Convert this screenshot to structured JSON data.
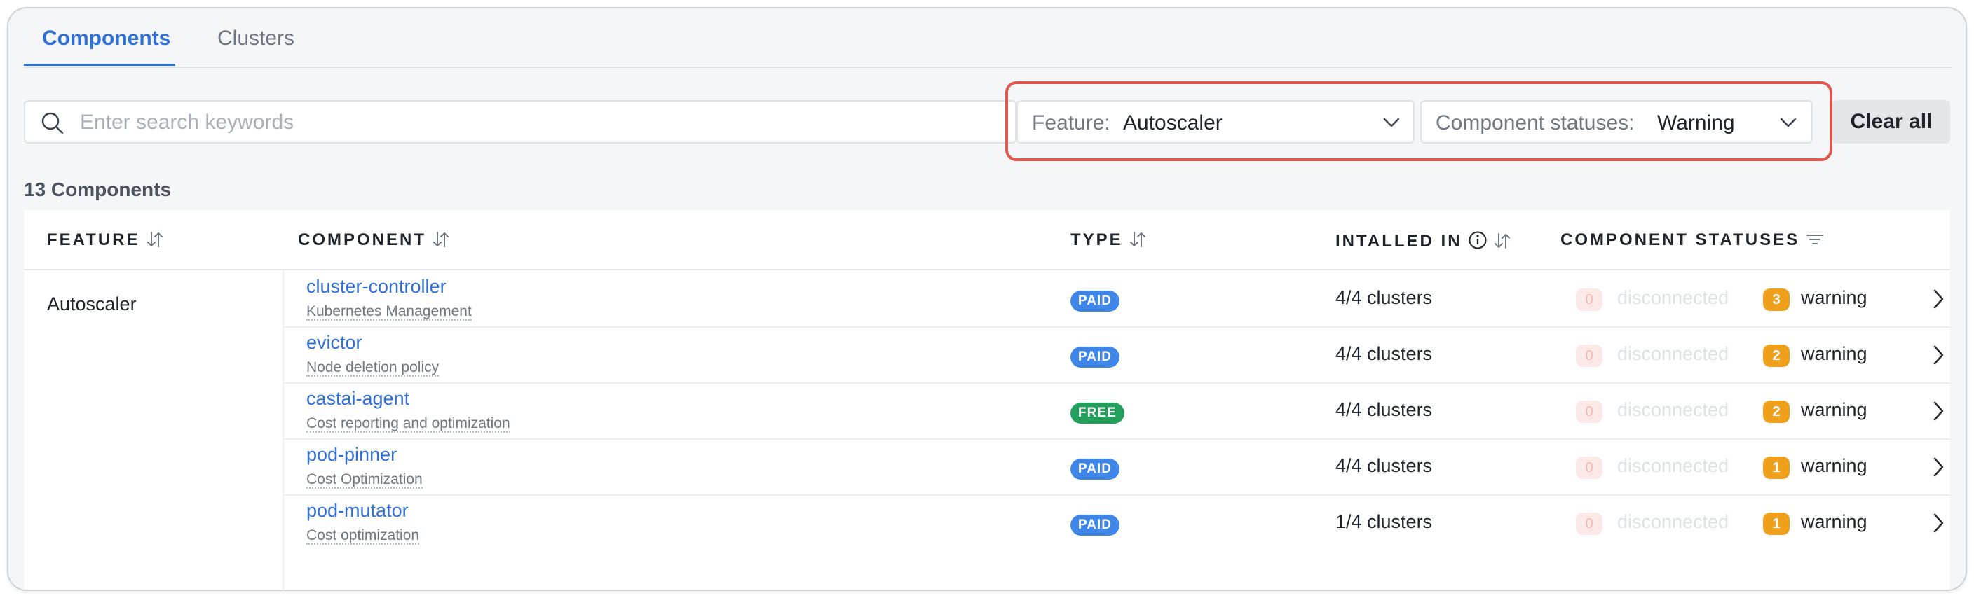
{
  "tabs": [
    {
      "label": "Components",
      "active": true
    },
    {
      "label": "Clusters",
      "active": false
    }
  ],
  "search": {
    "placeholder": "Enter search keywords",
    "value": ""
  },
  "filters": {
    "feature": {
      "label": "Feature:",
      "value": "Autoscaler"
    },
    "status": {
      "label": "Component statuses:",
      "value": "Warning"
    },
    "clear_label": "Clear all"
  },
  "count_label": "13 Components",
  "table": {
    "headers": {
      "feature": "FEATURE",
      "component": "COMPONENT",
      "type": "TYPE",
      "installed": "INTALLED IN",
      "statuses": "COMPONENT STATUSES"
    },
    "feature_value": "Autoscaler",
    "rows": [
      {
        "name": "cluster-controller",
        "description": "Kubernetes Management",
        "type": "PAID",
        "installed": "4/4 clusters",
        "disconnected_count": "0",
        "disconnected_label": "disconnected",
        "warning_count": "3",
        "warning_label": "warning"
      },
      {
        "name": "evictor",
        "description": "Node deletion policy",
        "type": "PAID",
        "installed": "4/4 clusters",
        "disconnected_count": "0",
        "disconnected_label": "disconnected",
        "warning_count": "2",
        "warning_label": "warning"
      },
      {
        "name": "castai-agent",
        "description": "Cost reporting and optimization",
        "type": "FREE",
        "installed": "4/4 clusters",
        "disconnected_count": "0",
        "disconnected_label": "disconnected",
        "warning_count": "2",
        "warning_label": "warning"
      },
      {
        "name": "pod-pinner",
        "description": "Cost Optimization",
        "type": "PAID",
        "installed": "4/4 clusters",
        "disconnected_count": "0",
        "disconnected_label": "disconnected",
        "warning_count": "1",
        "warning_label": "warning"
      },
      {
        "name": "pod-mutator",
        "description": "Cost optimization",
        "type": "PAID",
        "installed": "1/4 clusters",
        "disconnected_count": "0",
        "disconnected_label": "disconnected",
        "warning_count": "1",
        "warning_label": "warning"
      }
    ]
  },
  "colors": {
    "accent": "#2f6fd6",
    "paid": "#3f86e8",
    "free": "#22a05b",
    "warning": "#ee9f1c",
    "highlight": "#e0574f"
  }
}
